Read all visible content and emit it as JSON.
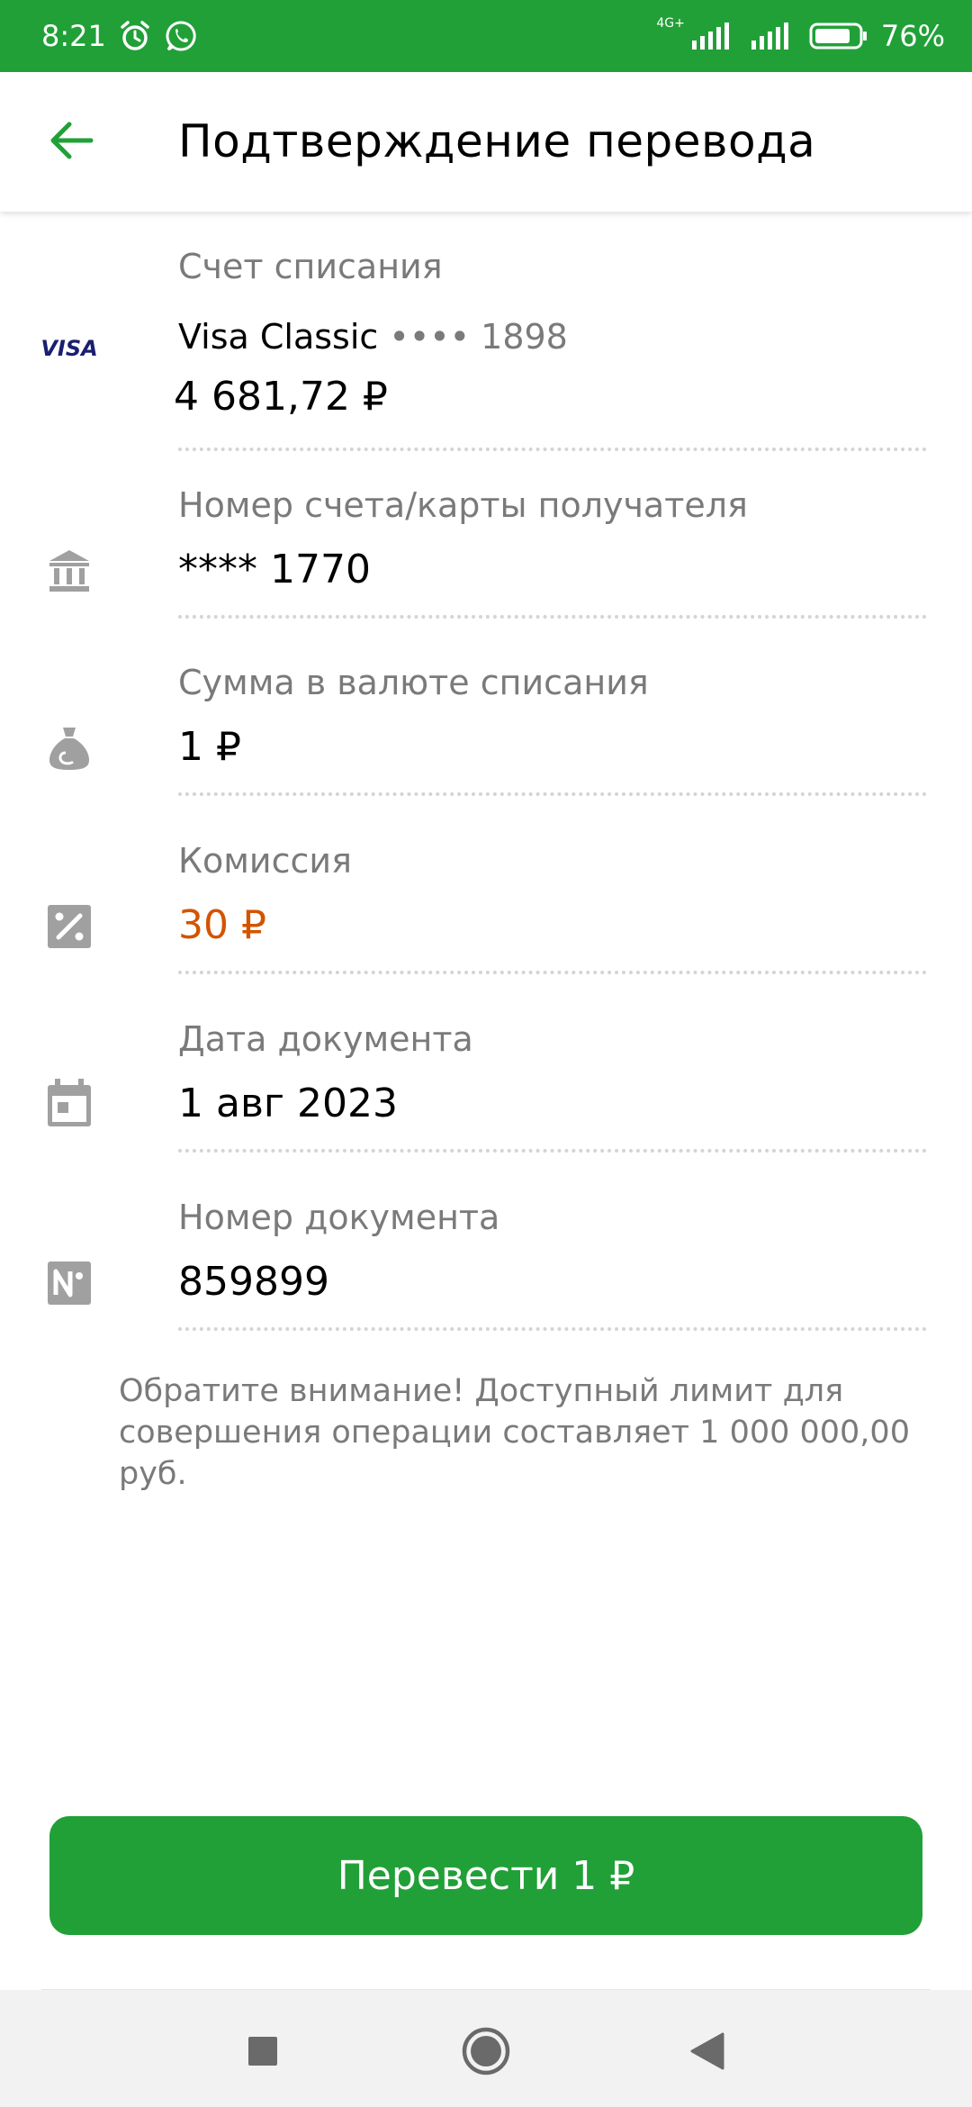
{
  "status_bar": {
    "time": "8:21",
    "network": "4G+",
    "battery": "76%",
    "icons": [
      "alarm-icon",
      "whatsapp-icon",
      "signal-icon",
      "battery-icon"
    ]
  },
  "header": {
    "title": "Подтверждение перевода",
    "back_icon": "arrow-left-icon"
  },
  "fields": {
    "source": {
      "label": "Счет списания",
      "card_name": "Visa Classic",
      "card_mask": "•••• 1898",
      "balance": "4 681,72 ₽",
      "logo_text": "VISA"
    },
    "recipient": {
      "label": "Номер счета/карты получателя",
      "value": "**** 1770"
    },
    "amount": {
      "label": "Сумма в валюте списания",
      "value": "1 ₽"
    },
    "commission": {
      "label": "Комиссия",
      "value": "30 ₽"
    },
    "doc_date": {
      "label": "Дата документа",
      "value": "1 авг 2023"
    },
    "doc_number": {
      "label": "Номер документа",
      "value": "859899"
    }
  },
  "notice": "Обратите внимание! Доступный лимит для совершения операции составляет 1 000 000,00 руб.",
  "action": {
    "label": "Перевести 1 ₽"
  },
  "colors": {
    "brand": "#21a038",
    "commission": "#d35400",
    "label": "#7a7a7a"
  }
}
